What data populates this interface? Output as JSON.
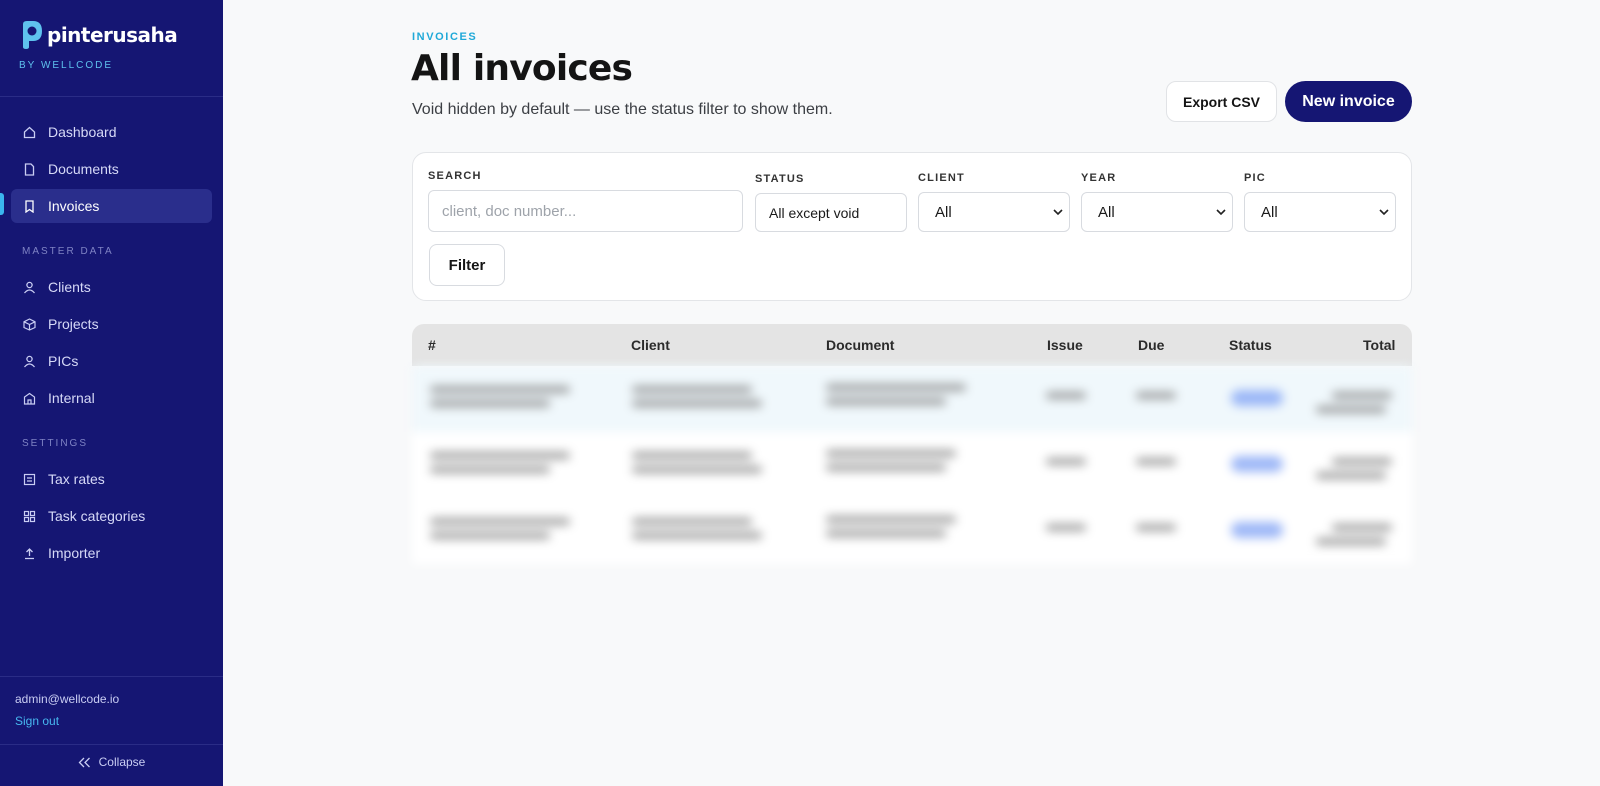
{
  "brand": {
    "name": "pinterusaha",
    "sub": "BY WELLCODE",
    "accent": "#5fc2ee"
  },
  "sidebar": {
    "background": "#151673",
    "items_main": [
      {
        "label": "Dashboard",
        "icon": "home-icon",
        "active": false
      },
      {
        "label": "Documents",
        "icon": "document-icon",
        "active": false
      },
      {
        "label": "Invoices",
        "icon": "bookmark-icon",
        "active": true
      }
    ],
    "section_master": "MASTER DATA",
    "items_master": [
      {
        "label": "Clients",
        "icon": "user-icon"
      },
      {
        "label": "Projects",
        "icon": "box-icon"
      },
      {
        "label": "PICs",
        "icon": "user-icon"
      },
      {
        "label": "Internal",
        "icon": "building-icon"
      }
    ],
    "section_settings": "SETTINGS",
    "items_settings": [
      {
        "label": "Tax rates",
        "icon": "receipt-icon"
      },
      {
        "label": "Task categories",
        "icon": "grid-icon"
      },
      {
        "label": "Importer",
        "icon": "upload-icon"
      }
    ],
    "user_email": "admin@wellcode.io",
    "sign_out": "Sign out",
    "collapse": "Collapse"
  },
  "page": {
    "eyebrow": "INVOICES",
    "title": "All invoices",
    "subtitle": "Void hidden by default — use the status filter to show them.",
    "export_label": "Export CSV",
    "new_label": "New invoice"
  },
  "filters": {
    "search_label": "SEARCH",
    "search_placeholder": "client, doc number...",
    "status_label": "STATUS",
    "status_value": "All except void",
    "client_label": "CLIENT",
    "client_value": "All",
    "year_label": "YEAR",
    "year_value": "All",
    "pic_label": "PIC",
    "pic_value": "All",
    "filter_button": "Filter"
  },
  "table": {
    "columns": [
      "#",
      "Client",
      "Document",
      "Issue",
      "Due",
      "Status",
      "Total"
    ],
    "rows_blurred": 3
  }
}
